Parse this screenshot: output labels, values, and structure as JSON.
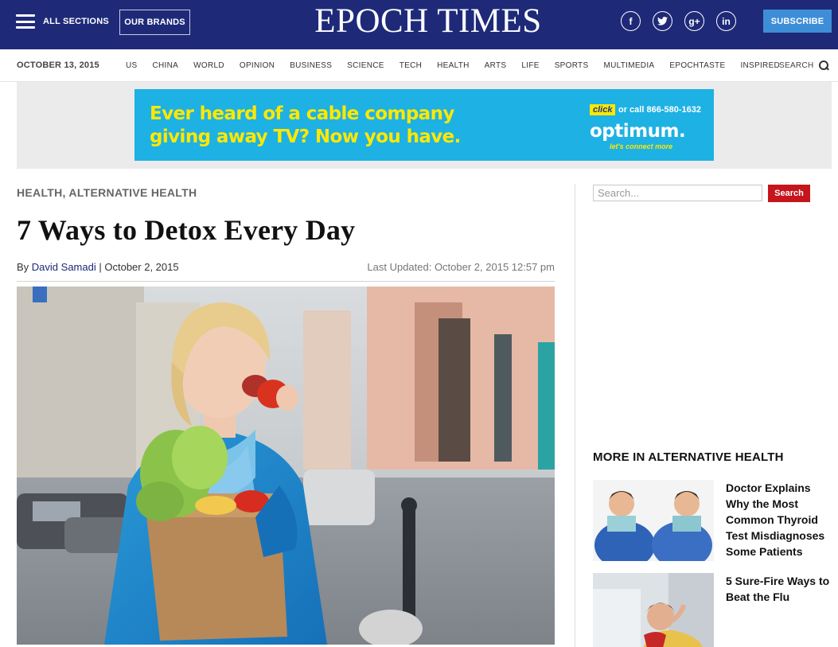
{
  "header": {
    "menu_label": "ALL SECTIONS",
    "brands_label": "OUR BRANDS",
    "logo": "EPOCH TIMES",
    "social": [
      {
        "icon": "facebook-icon",
        "glyph": "f"
      },
      {
        "icon": "twitter-icon",
        "glyph": "t"
      },
      {
        "icon": "google-plus-icon",
        "glyph": "g+"
      },
      {
        "icon": "linkedin-icon",
        "glyph": "in"
      }
    ],
    "subscribe_label": "SUBSCRIBE",
    "colors": {
      "bar": "#1e2a78",
      "subscribe": "#3d8ed7"
    }
  },
  "nav": {
    "date": "OCTOBER 13, 2015",
    "items": [
      "US",
      "CHINA",
      "WORLD",
      "OPINION",
      "BUSINESS",
      "SCIENCE",
      "TECH",
      "HEALTH",
      "ARTS",
      "LIFE",
      "SPORTS",
      "MULTIMEDIA",
      "EPOCHTASTE",
      "INSPIRED"
    ],
    "search_label": "SEARCH"
  },
  "ad": {
    "headline_line1": "Ever heard of a cable company",
    "headline_line2": "giving away TV? Now you have.",
    "click_label": "click",
    "call_text": "or call 866-580-1632",
    "brand": "optimum.",
    "tagline": "let's connect more",
    "colors": {
      "bg": "#1eb1e3",
      "accent": "#ffe800"
    }
  },
  "article": {
    "categories": [
      "HEALTH",
      "ALTERNATIVE HEALTH"
    ],
    "title": "7 Ways to Detox Every Day",
    "by_prefix": "By",
    "author": "David Samadi",
    "separator": "|",
    "date": "October 2, 2015",
    "last_updated": "Last Updated: October 2, 2015 12:57 pm"
  },
  "sidebar": {
    "search_placeholder": "Search...",
    "search_button": "Search",
    "more_heading": "MORE IN ALTERNATIVE HEALTH",
    "related": [
      {
        "title": "Doctor Explains Why the Most Common Thyroid Test Misdiagnoses Some Patients"
      },
      {
        "title": "5 Sure-Fire Ways to Beat the Flu"
      }
    ],
    "colors": {
      "search_button": "#c4161c"
    }
  }
}
